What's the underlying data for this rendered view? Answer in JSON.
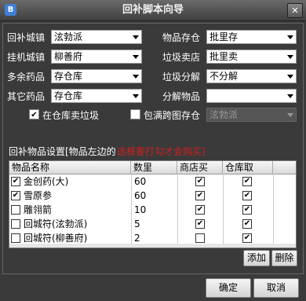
{
  "window": {
    "title": "回补脚本向导",
    "close": "✕",
    "icon_letter": "B"
  },
  "form": {
    "left": [
      {
        "label": "回补城镇",
        "value": "泫勃派"
      },
      {
        "label": "挂机城镇",
        "value": "柳善府"
      },
      {
        "label": "多余药品",
        "value": "存仓库"
      },
      {
        "label": "其它药品",
        "value": "存仓库"
      }
    ],
    "right": [
      {
        "label": "物品存仓",
        "value": "批里存"
      },
      {
        "label": "垃圾卖店",
        "value": "批里卖"
      },
      {
        "label": "垃圾分解",
        "value": "不分解"
      },
      {
        "label": "分解物品",
        "value": ""
      }
    ],
    "sell_trash": {
      "label": "在仓库卖垃圾",
      "checked": true
    },
    "full_bag": {
      "label": "包满跨图存仓",
      "checked": false
    },
    "full_bag_town": "泫勃派"
  },
  "items_section": {
    "title": "回补物品设置[物品左边的",
    "hint": "选框要打勾才会购买]",
    "columns": [
      "物品名称",
      "数里",
      "商店买",
      "仓库取"
    ],
    "rows": [
      {
        "checked": true,
        "name": "金创药(大)",
        "qty": "60",
        "shop": true,
        "store": true
      },
      {
        "checked": true,
        "name": "雪原参",
        "qty": "60",
        "shop": true,
        "store": true
      },
      {
        "checked": false,
        "name": "雕翎箭",
        "qty": "10",
        "shop": true,
        "store": true
      },
      {
        "checked": false,
        "name": "回城符(泫勃派)",
        "qty": "5",
        "shop": true,
        "store": true
      },
      {
        "checked": false,
        "name": "回城符(柳善府)",
        "qty": "2",
        "shop": false,
        "store": true
      }
    ]
  },
  "buttons": {
    "add": "添加",
    "delete": "删除",
    "ok": "确定",
    "cancel": "取消"
  }
}
